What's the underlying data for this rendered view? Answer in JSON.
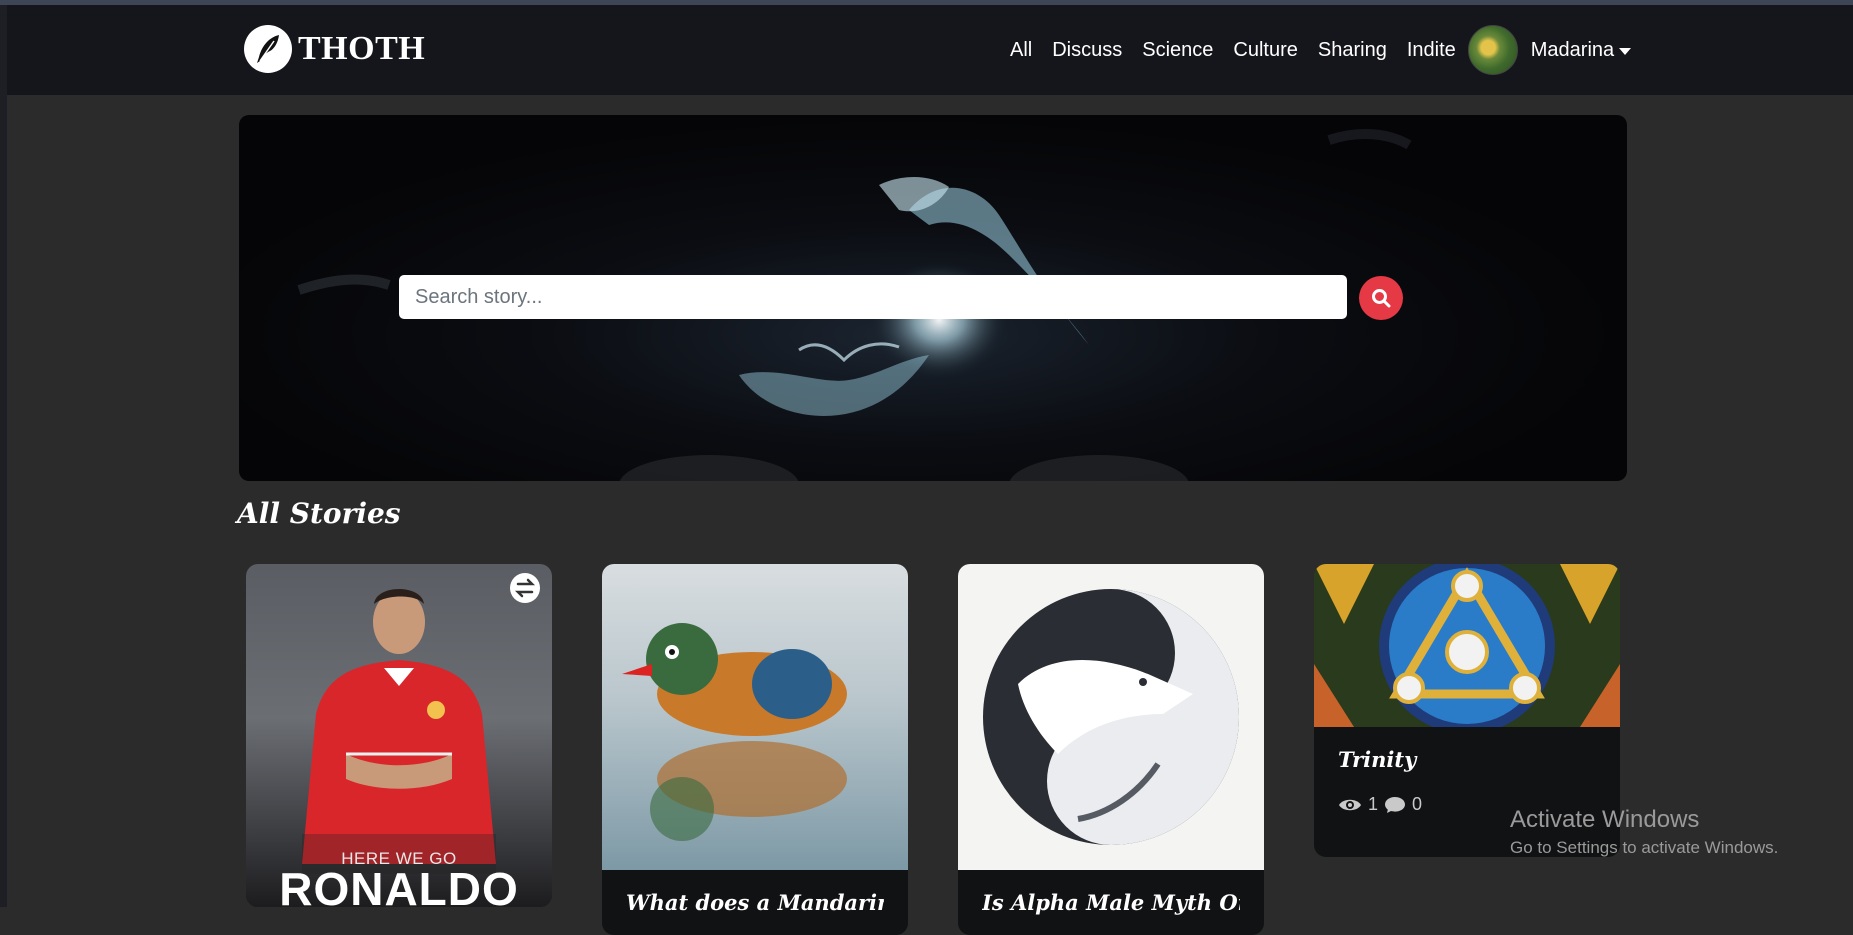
{
  "brand": {
    "name": "THOTH",
    "icon": "quill-icon"
  },
  "nav": {
    "links": [
      "All",
      "Discuss",
      "Science",
      "Culture",
      "Sharing",
      "Indite"
    ],
    "user": {
      "name": "Madarina",
      "avatar_icon": "bird-avatar"
    }
  },
  "hero": {
    "search_placeholder": "Search story...",
    "search_icon": "search-icon"
  },
  "section": {
    "title": "All Stories"
  },
  "cards": [
    {
      "image_desc": "ronaldo-portrait",
      "image_text_small": "HERE WE GO",
      "image_text_big": "RONALDO",
      "title": "",
      "badge_icon": "swap-icon"
    },
    {
      "image_desc": "mandarin-duck",
      "title": "What does a Mandarin Duck"
    },
    {
      "image_desc": "wolf-yin-yang",
      "title": "Is Alpha Male Myth Or"
    },
    {
      "image_desc": "stained-glass-trinity",
      "title": "Trinity",
      "views": "1",
      "comments": "0"
    }
  ],
  "watermark": {
    "line1": "Activate Windows",
    "line2": "Go to Settings to activate Windows."
  },
  "colors": {
    "accent": "#e63946",
    "navbar": "#15161b",
    "page": "#2b2b2b"
  }
}
